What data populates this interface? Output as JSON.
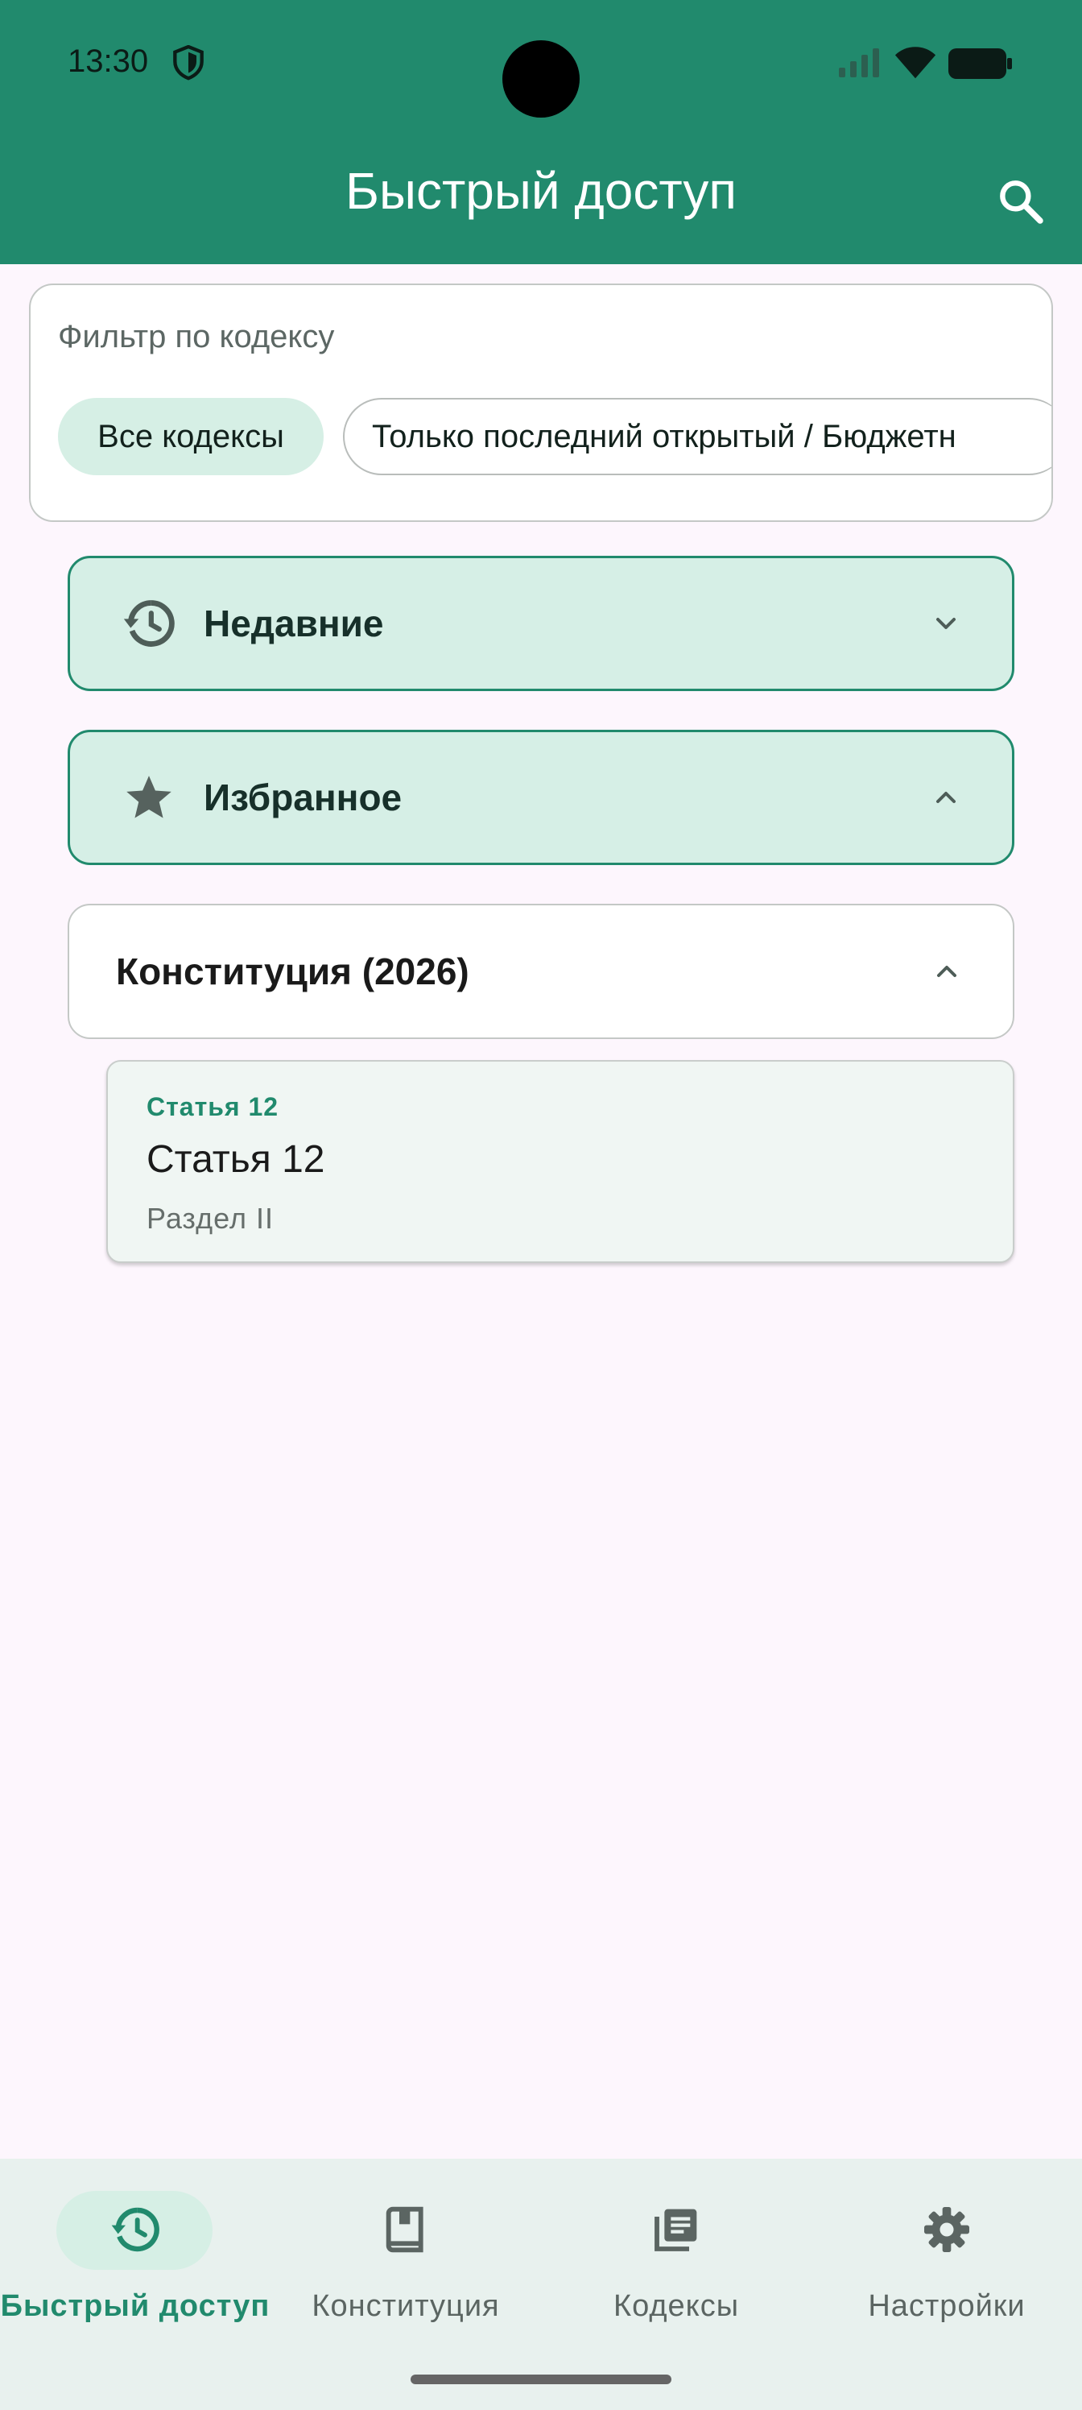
{
  "status": {
    "time": "13:30"
  },
  "appbar": {
    "title": "Быстрый доступ",
    "search_icon": "search-icon"
  },
  "filter": {
    "title": "Фильтр по кодексу",
    "chips": [
      {
        "label": "Все кодексы",
        "selected": true
      },
      {
        "label": "Только последний открытый / Бюджетн",
        "selected": false
      }
    ]
  },
  "sections": {
    "recent": {
      "label": "Недавние",
      "icon": "history-icon",
      "expanded": false
    },
    "favorites": {
      "label": "Избранное",
      "icon": "star-icon",
      "expanded": true
    },
    "constitution": {
      "label": "Конституция (2026)",
      "expanded": true
    }
  },
  "favorite_item": {
    "kicker": "Статья 12",
    "title": "Статья 12",
    "subtitle": "Раздел II"
  },
  "bottom_nav": {
    "items": [
      {
        "label": "Быстрый доступ",
        "icon": "history-icon",
        "active": true
      },
      {
        "label": "Конституция",
        "icon": "book-icon",
        "active": false
      },
      {
        "label": "Кодексы",
        "icon": "library-icon",
        "active": false
      },
      {
        "label": "Настройки",
        "icon": "gear-icon",
        "active": false
      }
    ]
  },
  "colors": {
    "primary": "#218a6d",
    "tint": "#d6efe6",
    "background": "#fdf6fd",
    "nav_background": "#e8f1ee"
  }
}
